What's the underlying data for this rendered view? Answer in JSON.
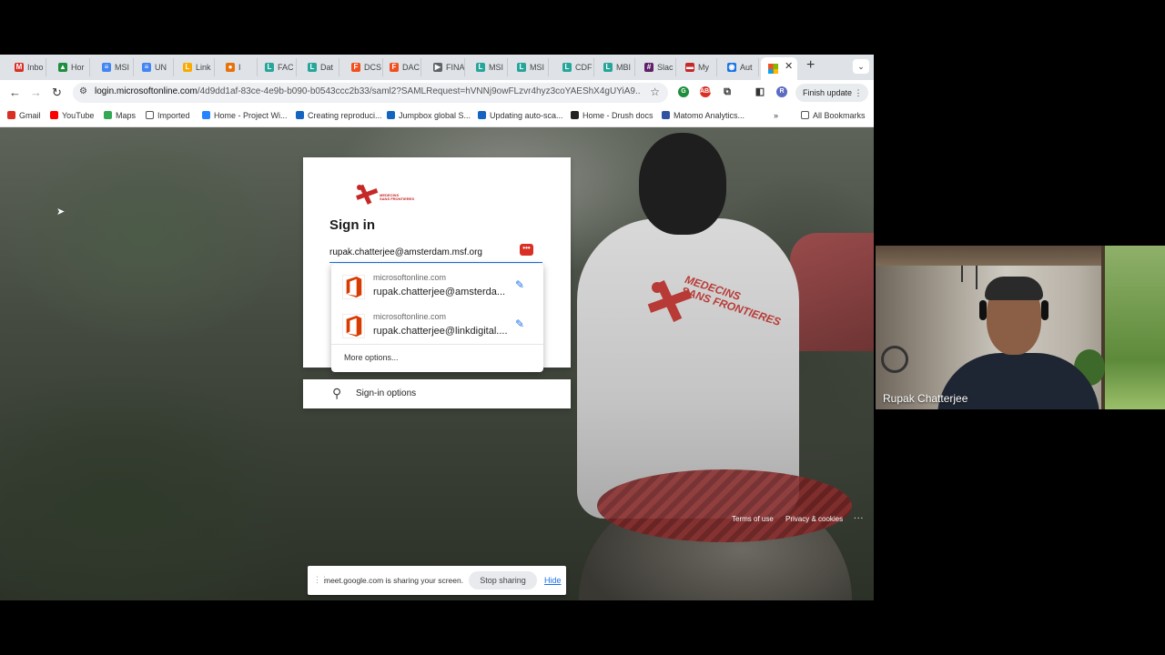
{
  "browser": {
    "tabs": [
      {
        "label": "Inbo",
        "icon": "gmail-icon",
        "color": "#d93025",
        "glyph": "M"
      },
      {
        "label": "Hor",
        "icon": "drive-icon",
        "color": "#1e8e3e",
        "glyph": "▲"
      },
      {
        "label": "MSI",
        "icon": "docs-icon",
        "color": "#4285f4",
        "glyph": "≡"
      },
      {
        "label": "UN",
        "icon": "docs-icon",
        "color": "#4285f4",
        "glyph": "≡"
      },
      {
        "label": "Link",
        "icon": "classroom-icon",
        "color": "#f9ab00",
        "glyph": "L"
      },
      {
        "label": "I",
        "icon": "recording-icon",
        "color": "#e8710a",
        "glyph": "●"
      },
      {
        "label": "FAC",
        "icon": "link-digital-icon",
        "color": "#26a69a",
        "glyph": "L"
      },
      {
        "label": "Dat",
        "icon": "link-digital-icon",
        "color": "#26a69a",
        "glyph": "L"
      },
      {
        "label": "DCS",
        "icon": "figma-icon",
        "color": "#f24e1e",
        "glyph": "F"
      },
      {
        "label": "DAC",
        "icon": "figma-icon",
        "color": "#f24e1e",
        "glyph": "F"
      },
      {
        "label": "FINA",
        "icon": "video-icon",
        "color": "#5f6368",
        "glyph": "▶"
      },
      {
        "label": "MSI",
        "icon": "link-digital-icon",
        "color": "#26a69a",
        "glyph": "L"
      },
      {
        "label": "MSI",
        "icon": "link-digital-icon",
        "color": "#26a69a",
        "glyph": "L"
      },
      {
        "label": "CDF",
        "icon": "link-digital-icon",
        "color": "#26a69a",
        "glyph": "L"
      },
      {
        "label": "MBI",
        "icon": "link-digital-icon",
        "color": "#26a69a",
        "glyph": "L"
      },
      {
        "label": "Slac",
        "icon": "slack-icon",
        "color": "#611f69",
        "glyph": "#"
      },
      {
        "label": "My",
        "icon": "app-icon",
        "color": "#c62828",
        "glyph": "▬"
      },
      {
        "label": "Aut",
        "icon": "globe-icon",
        "color": "#1a73e8",
        "glyph": "◉"
      }
    ],
    "active_tab_icon": "microsoft-icon",
    "url_host": "login.microsoftonline.com",
    "url_path": "/4d9dd1af-83ce-4e9b-b090-b0543ccc2b33/saml2?SAMLRequest=hVNNj9owFLzvr4hyz3coYAEShX4gUYiA9...",
    "finish_update": "Finish update",
    "profile_initial": "R",
    "bookmarks": [
      {
        "label": "Gmail",
        "icon": "gmail-icon",
        "color": "#d93025"
      },
      {
        "label": "YouTube",
        "icon": "youtube-icon",
        "color": "#ff0000"
      },
      {
        "label": "Maps",
        "icon": "maps-icon",
        "color": "#34a853"
      },
      {
        "label": "Imported",
        "icon": "folder-icon",
        "color": "#ffffff"
      },
      {
        "label": "Home - Project Wi...",
        "icon": "atlassian-icon",
        "color": "#2684ff"
      },
      {
        "label": "Creating reproduci...",
        "icon": "jumpbox-icon",
        "color": "#1565c0"
      },
      {
        "label": "Jumpbox global S...",
        "icon": "jumpbox-icon",
        "color": "#1565c0"
      },
      {
        "label": "Updating auto-sca...",
        "icon": "jumpbox-icon",
        "color": "#1565c0"
      },
      {
        "label": "Home - Drush docs",
        "icon": "drush-icon",
        "color": "#222222"
      },
      {
        "label": "Matomo Analytics...",
        "icon": "matomo-icon",
        "color": "#3152a0"
      }
    ],
    "all_bookmarks": "All Bookmarks"
  },
  "signin": {
    "logo_text_1": "MEDECINS",
    "logo_text_2": "SANS FRONTIERES",
    "title": "Sign in",
    "email": "rupak.chatterjee@amsterdam.msf.org",
    "autofill": [
      {
        "site": "microsoftonline.com",
        "user": "rupak.chatterjee@amsterda..."
      },
      {
        "site": "microsoftonline.com",
        "user": "rupak.chatterjee@linkdigital...."
      }
    ],
    "more_options": "More options...",
    "signin_options": "Sign-in options"
  },
  "background": {
    "shirt_text_1": "MEDECINS",
    "shirt_text_2": "SANS FRONTIERES"
  },
  "footer": {
    "terms": "Terms of use",
    "privacy": "Privacy & cookies",
    "more": "..."
  },
  "share_bar": {
    "message": "meet.google.com is sharing your screen.",
    "stop": "Stop sharing",
    "hide": "Hide"
  },
  "video": {
    "name": "Rupak Chatterjee"
  }
}
